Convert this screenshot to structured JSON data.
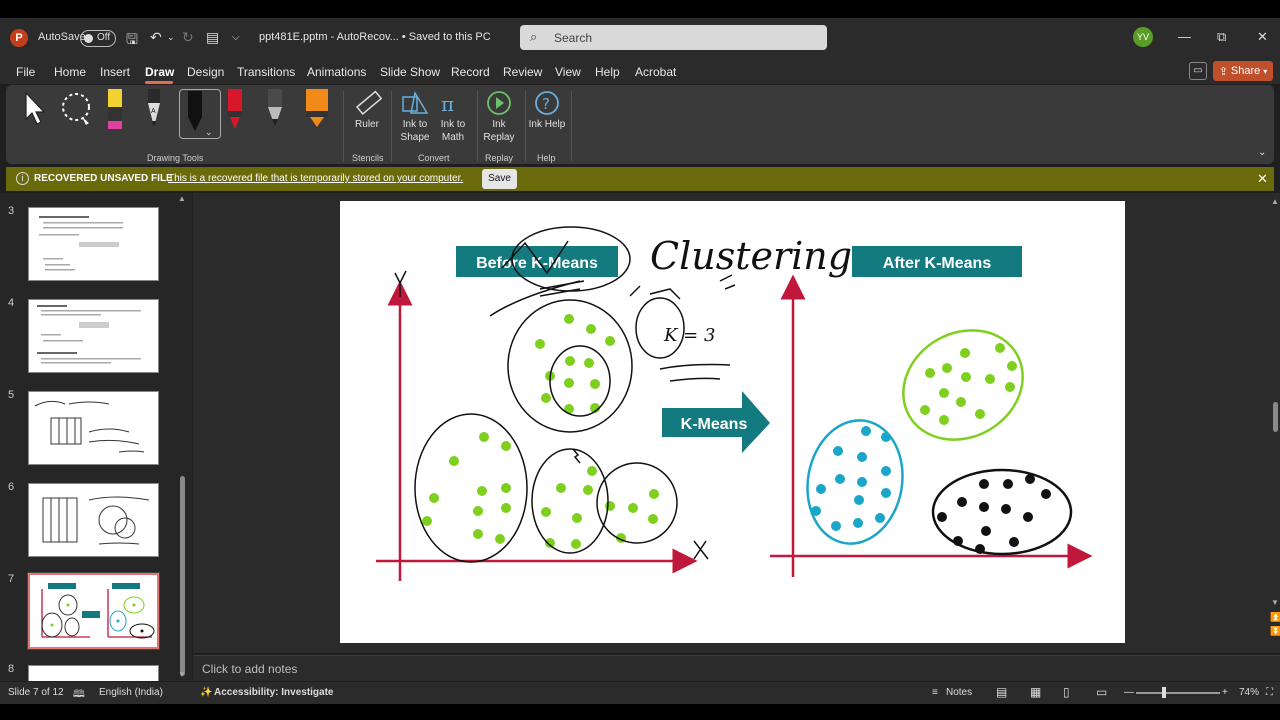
{
  "titlebar": {
    "app_logo": "P",
    "autosave_label": "AutoSave",
    "autosave_state": "Off",
    "doc_title": "ppt481E.pptm  -  AutoRecov...  •  Saved to this PC",
    "search_placeholder": "Search",
    "user_initials": "YV"
  },
  "menu": {
    "tabs": [
      "File",
      "Home",
      "Insert",
      "Draw",
      "Design",
      "Transitions",
      "Animations",
      "Slide Show",
      "Record",
      "Review",
      "View",
      "Help",
      "Acrobat"
    ],
    "active": "Draw",
    "share_label": "Share"
  },
  "ribbon": {
    "groups": {
      "drawing_tools": "Drawing Tools",
      "stencils": "Stencils",
      "convert": "Convert",
      "replay": "Replay",
      "help": "Help"
    },
    "buttons": {
      "ruler": "Ruler",
      "ink_to_shape": "Ink to Shape",
      "ink_to_math": "Ink to Math",
      "ink_replay": "Ink Replay",
      "ink_help": "Ink Help"
    },
    "pen_colors": [
      "#f2d22e",
      "#2a2a2a",
      "#111111",
      "#d8182a",
      "#4a4a4a",
      "#f28a1a"
    ]
  },
  "infobar": {
    "title": "RECOVERED UNSAVED FILE",
    "message": "This is a recovered file that is temporarily stored on your computer.",
    "save_label": "Save"
  },
  "slides_panel": {
    "numbers": [
      "3",
      "4",
      "5",
      "6",
      "7",
      "8"
    ],
    "selected": "7"
  },
  "slide": {
    "before_label": "Before K-Means",
    "after_label": "After K-Means",
    "arrow_label": "K-Means",
    "ink_title": "Clustering",
    "ink_axis_y": "Y",
    "ink_axis_x": "X",
    "ink_note": "K = 3",
    "accent_teal": "#137a80",
    "axis_red": "#c0183a",
    "dot_green": "#7fcf1f",
    "dot_blue": "#1aa6c8"
  },
  "notes": {
    "placeholder": "Click to add notes"
  },
  "status": {
    "slide_indicator": "Slide 7 of 12",
    "language": "English (India)",
    "accessibility": "Accessibility: Investigate",
    "notes_label": "Notes",
    "zoom": "74%"
  }
}
